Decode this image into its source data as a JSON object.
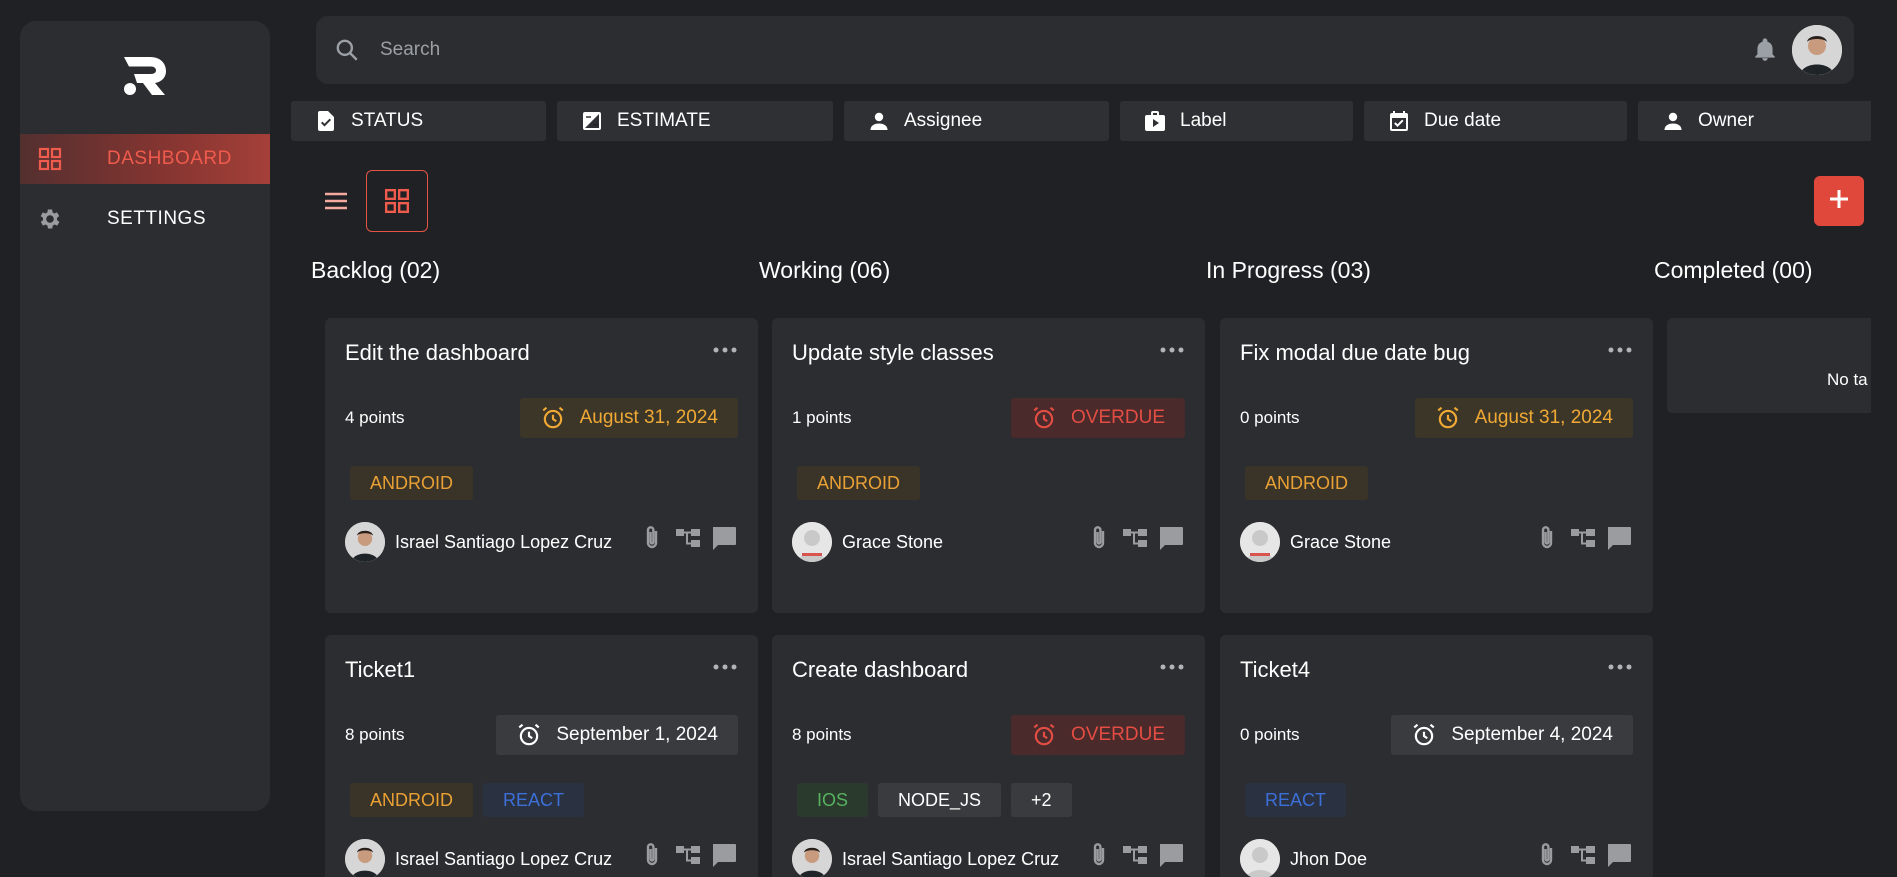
{
  "colors": {
    "background": "#202124",
    "panel": "#2c2d30",
    "accent": "#e0483c",
    "orange": "#f0a935",
    "red": "#e34d43",
    "blue": "#3d6fd9",
    "green": "#57b260"
  },
  "sidebar": {
    "logo_icon": "r-logo-icon",
    "items": [
      {
        "label": "DASHBOARD",
        "icon": "grid-icon",
        "active": true
      },
      {
        "label": "SETTINGS",
        "icon": "gear-icon",
        "active": false
      }
    ]
  },
  "topbar": {
    "search_placeholder": "Search",
    "icons": [
      "search-icon",
      "bell-icon",
      "avatar"
    ]
  },
  "filters": [
    {
      "label": "STATUS",
      "icon": "checklist-icon"
    },
    {
      "label": "ESTIMATE",
      "icon": "calculator-icon"
    },
    {
      "label": "Assignee",
      "icon": "person-icon"
    },
    {
      "label": "Label",
      "icon": "label-bag-icon"
    },
    {
      "label": "Due date",
      "icon": "calendar-check-icon"
    },
    {
      "label": "Owner",
      "icon": "person-icon"
    }
  ],
  "view": {
    "modes": [
      "list-view-icon",
      "grid-view-icon"
    ],
    "active": "grid",
    "add_icon": "plus-icon"
  },
  "columns": [
    {
      "title": "Backlog (02)"
    },
    {
      "title": "Working (06)"
    },
    {
      "title": "In Progress (03)"
    },
    {
      "title": "Completed (00)"
    }
  ],
  "cards": [
    {
      "title": "Edit the dashboard",
      "points": "4 points",
      "date": "August 31, 2024",
      "tags": [
        {
          "label": "ANDROID"
        }
      ],
      "assignee": "Israel Santiago Lopez Cruz"
    },
    {
      "title": "Update style classes",
      "points": "1 points",
      "date": "OVERDUE",
      "tags": [
        {
          "label": "ANDROID"
        }
      ],
      "assignee": "Grace Stone"
    },
    {
      "title": "Fix modal due date bug",
      "points": "0 points",
      "date": "August 31, 2024",
      "tags": [
        {
          "label": "ANDROID"
        }
      ],
      "assignee": "Grace Stone"
    },
    {
      "title": "Ticket1",
      "points": "8 points",
      "date": "September 1, 2024",
      "tags": [
        {
          "label": "ANDROID"
        },
        {
          "label": "REACT"
        }
      ],
      "assignee": "Israel Santiago Lopez Cruz"
    },
    {
      "title": "Create dashboard",
      "points": "8 points",
      "date": "OVERDUE",
      "tags": [
        {
          "label": "IOS"
        },
        {
          "label": "NODE_JS"
        },
        {
          "label": "+2"
        }
      ],
      "assignee": "Israel Santiago Lopez Cruz"
    },
    {
      "title": "Ticket4",
      "points": "0 points",
      "date": "September 4, 2024",
      "tags": [
        {
          "label": "REACT"
        }
      ],
      "assignee": "Jhon Doe"
    }
  ],
  "completed_empty_text": "No ta",
  "card_icons": [
    "paperclip-icon",
    "subtask-icon",
    "comment-icon"
  ]
}
